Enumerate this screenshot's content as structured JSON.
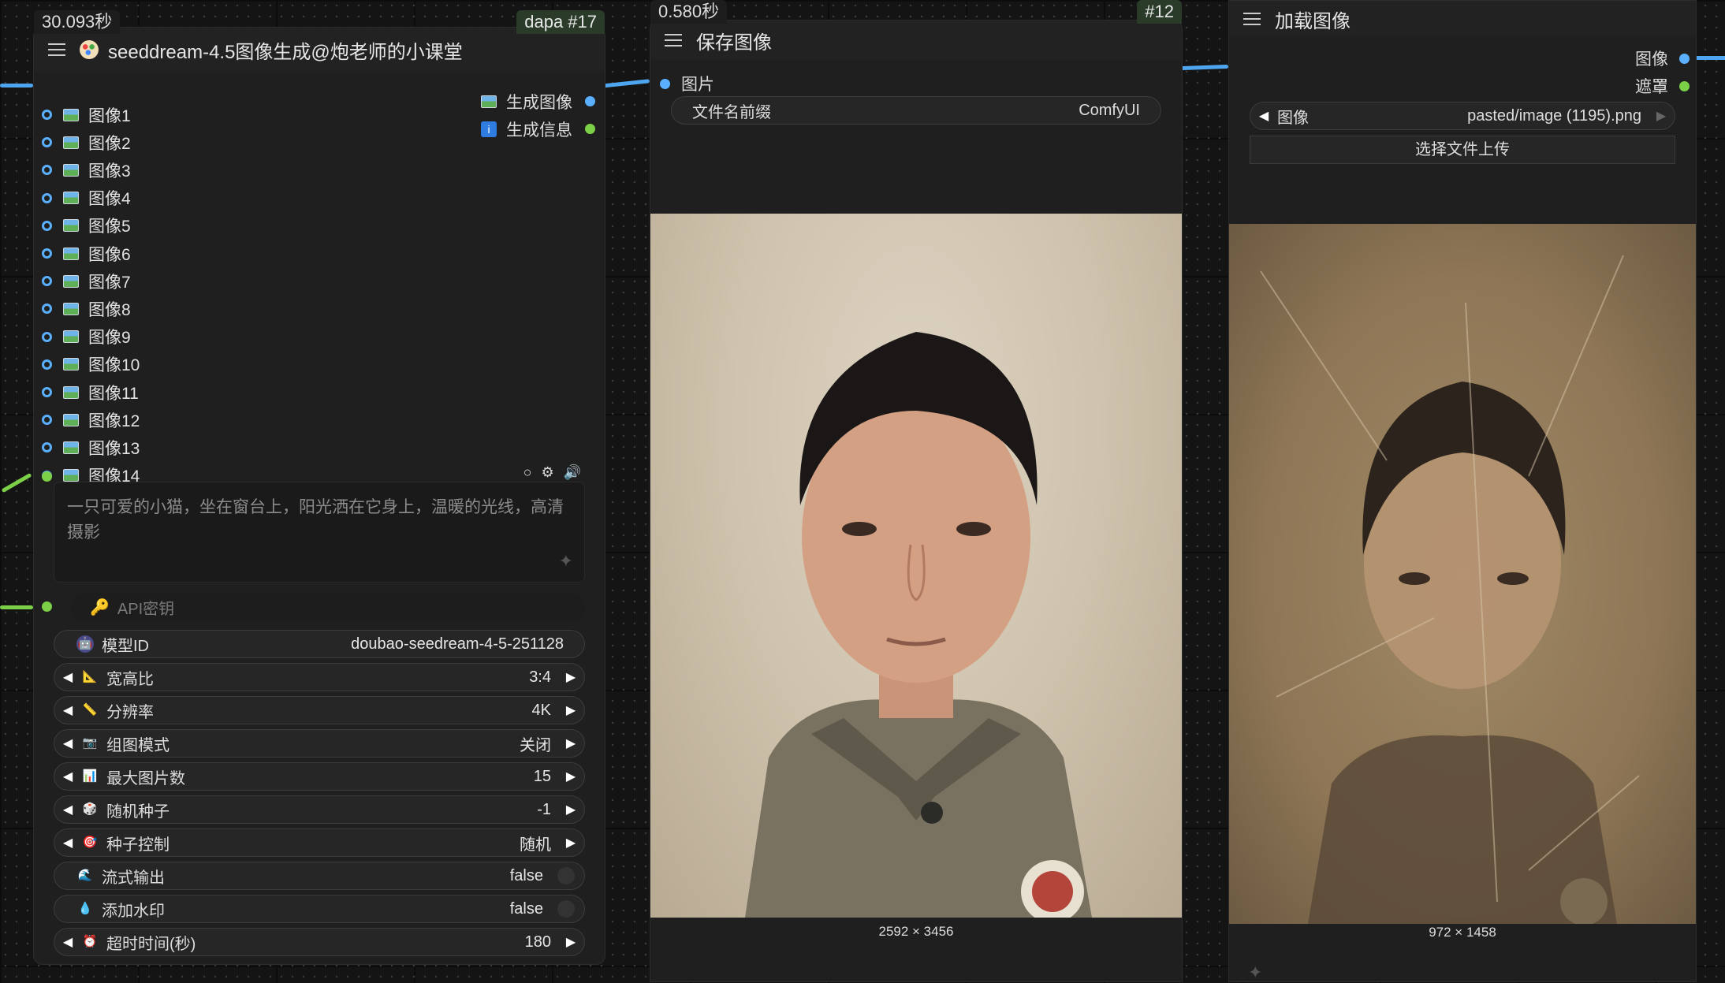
{
  "node1": {
    "timing": "30.093秒",
    "badge": "dapa  #17",
    "title": "seeddream-4.5图像生成@炮老师的小课堂",
    "inputs": [
      "图像1",
      "图像2",
      "图像3",
      "图像4",
      "图像5",
      "图像6",
      "图像7",
      "图像8",
      "图像9",
      "图像10",
      "图像11",
      "图像12",
      "图像13",
      "图像14"
    ],
    "outputs": [
      "生成图像",
      "生成信息"
    ],
    "prompt": "一只可爱的小猫，坐在窗台上，阳光洒在它身上，温暖的光线，高清摄影",
    "api_key_label": "API密钥",
    "widgets": [
      {
        "label": "模型ID",
        "value": "doubao-seedream-4-5-251128",
        "icon": "robot-icon",
        "kind": "text"
      },
      {
        "label": "宽高比",
        "value": "3:4",
        "icon": "triangle-ruler-icon",
        "kind": "combo"
      },
      {
        "label": "分辨率",
        "value": "4K",
        "icon": "ruler-icon",
        "kind": "combo"
      },
      {
        "label": "组图模式",
        "value": "关闭",
        "icon": "camera-icon",
        "kind": "combo"
      },
      {
        "label": "最大图片数",
        "value": "15",
        "icon": "bar-chart-icon",
        "kind": "combo"
      },
      {
        "label": "随机种子",
        "value": "-1",
        "icon": "dice-icon",
        "kind": "combo"
      },
      {
        "label": "种子控制",
        "value": "随机",
        "icon": "target-icon",
        "kind": "combo"
      },
      {
        "label": "流式输出",
        "value": "false",
        "icon": "wave-icon",
        "kind": "toggle"
      },
      {
        "label": "添加水印",
        "value": "false",
        "icon": "droplet-icon",
        "kind": "toggle"
      },
      {
        "label": "超时时间(秒)",
        "value": "180",
        "icon": "alarm-clock-icon",
        "kind": "combo"
      }
    ]
  },
  "node2": {
    "timing": "0.580秒",
    "badge": "#12",
    "title": "保存图像",
    "input": "图片",
    "prefix_label": "文件名前缀",
    "prefix_value": "ComfyUI",
    "dimensions": "2592 × 3456"
  },
  "node3": {
    "title": "加载图像",
    "outputs": [
      "图像",
      "遮罩"
    ],
    "file_label": "图像",
    "file_value": "pasted/image (1195).png",
    "upload_label": "选择文件上传",
    "dimensions": "972 × 1458"
  }
}
